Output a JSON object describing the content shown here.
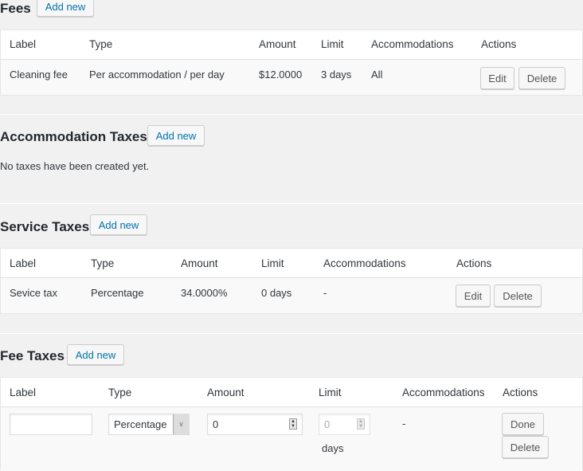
{
  "fees": {
    "title": "Fees",
    "add_label": "Add new",
    "columns": [
      "Label",
      "Type",
      "Amount",
      "Limit",
      "Accommodations",
      "Actions"
    ],
    "rows": [
      {
        "label": "Cleaning fee",
        "type": "Per accommodation / per day",
        "amount": "$12.0000",
        "limit": "3 days",
        "accommodations": "All",
        "edit": "Edit",
        "delete": "Delete"
      }
    ]
  },
  "accommodation_taxes": {
    "title": "Accommodation Taxes",
    "add_label": "Add new",
    "empty": "No taxes have been created yet."
  },
  "service_taxes": {
    "title": "Service Taxes",
    "add_label": "Add new",
    "columns": [
      "Label",
      "Type",
      "Amount",
      "Limit",
      "Accommodations",
      "Actions"
    ],
    "rows": [
      {
        "label": "Sevice tax",
        "type": "Percentage",
        "amount": "34.0000%",
        "limit": "0 days",
        "accommodations": "-",
        "edit": "Edit",
        "delete": "Delete"
      }
    ]
  },
  "fee_taxes": {
    "title": "Fee Taxes",
    "add_label": "Add new",
    "columns": [
      "Label",
      "Type",
      "Amount",
      "Limit",
      "Accommodations",
      "Actions"
    ],
    "edit_row": {
      "label_value": "",
      "type_value": "Percentage",
      "amount_value": "0",
      "limit_value": "0",
      "limit_unit": "days",
      "accommodations": "-",
      "done": "Done",
      "delete": "Delete"
    }
  }
}
